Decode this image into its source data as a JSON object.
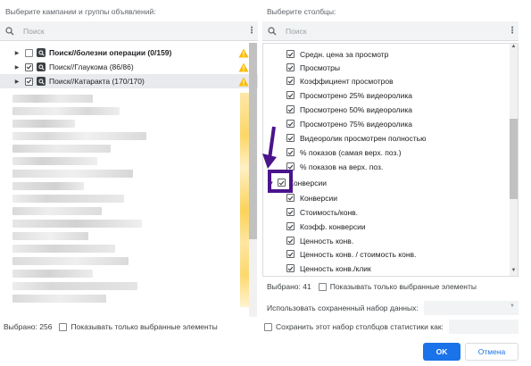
{
  "left": {
    "title": "Выберите кампании и группы объявлений:",
    "search_placeholder": "Поиск",
    "items": [
      {
        "label": "Поиск//болезни операции (0/159)",
        "checked": false,
        "bold": true
      },
      {
        "label": "Поиск//Глаукома (86/86)",
        "checked": true,
        "bold": false
      },
      {
        "label": "Поиск//Катаракта (170/170)",
        "checked": true,
        "bold": false
      }
    ],
    "footer_count": "Выбрано: 256",
    "footer_toggle": "Показывать только выбранные элементы"
  },
  "right": {
    "title": "Выберите столбцы:",
    "search_placeholder": "Поиск",
    "items": [
      {
        "label": "Средн. цена за просмотр"
      },
      {
        "label": "Просмотры"
      },
      {
        "label": "Коэффициент просмотров"
      },
      {
        "label": "Просмотрено 25% видеоролика"
      },
      {
        "label": "Просмотрено 50% видеоролика"
      },
      {
        "label": "Просмотрено 75% видеоролика"
      },
      {
        "label": "Видеоролик просмотрен полностью"
      },
      {
        "label": "% показов (самая верх. поз.)"
      },
      {
        "label": "% показов на верх. поз."
      }
    ],
    "group": {
      "label": "Конверсии"
    },
    "group_items": [
      {
        "label": "Конверсии"
      },
      {
        "label": "Стоимость/конв."
      },
      {
        "label": "Коэфф. конверсии"
      },
      {
        "label": "Ценность конв."
      },
      {
        "label": "Ценность конв. / стоимость конв."
      },
      {
        "label": "Ценность конв./клик"
      }
    ],
    "footer_count": "Выбрано: 41",
    "footer_toggle": "Показывать только выбранные элементы",
    "saved_set_label": "Использовать сохраненный набор данных:",
    "save_set_label": "Сохранить этот набор столбцов статистики как:"
  },
  "buttons": {
    "ok": "OK",
    "cancel": "Отмена"
  },
  "colors": {
    "accent": "#1a73e8",
    "warning": "#fbbc04",
    "highlight": "#4a148c"
  }
}
